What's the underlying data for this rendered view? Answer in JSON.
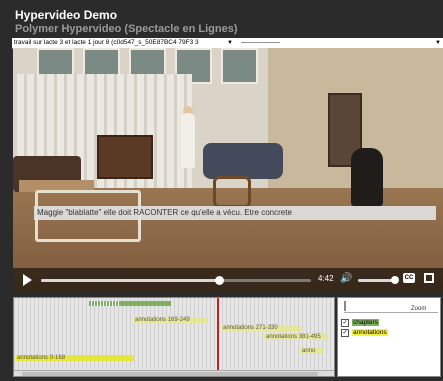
{
  "app": {
    "title": "Hypervideo Demo",
    "subtitle": "Polymer Hypervideo (Spectacle en Lignes)"
  },
  "selectors": {
    "video_select": "travail sur lacte 3 et lacte 1 jour 8 (c0d547_s_50E87BC4 79F3 3",
    "video_select_arrow": "▼",
    "track_select": "――――――",
    "track_select_arrow": "▼"
  },
  "player": {
    "caption": "Maggie \"blablatte\" elle doit RACONTER ce qu'elle a vécu. Etre concrete",
    "current_time": "4:42",
    "progress_fraction": 0.66,
    "cc_label": "CC",
    "volume_icon": "speaker-icon",
    "fullscreen_icon": "fullscreen-icon"
  },
  "timeline": {
    "annotations": [
      {
        "label": "annotations 169-249",
        "color": "#e6e69a"
      },
      {
        "label": "annotations 271-330",
        "color": "#e6e69a"
      },
      {
        "label": "annotations 381-495",
        "color": "#e6e69a"
      },
      {
        "label": "annotations 0-168",
        "color": "#e6e63c"
      },
      {
        "label": "anno",
        "color": "#e6e69a"
      }
    ],
    "chapters_color": "#7fb060",
    "cursor_color": "#c81e1e"
  },
  "legend": {
    "zoom_label": "Zoom",
    "items": [
      {
        "label": "chapters",
        "checked": "✓",
        "color": "#7fb060"
      },
      {
        "label": "annotations",
        "checked": "✓",
        "color": "#f3f33c"
      }
    ]
  }
}
